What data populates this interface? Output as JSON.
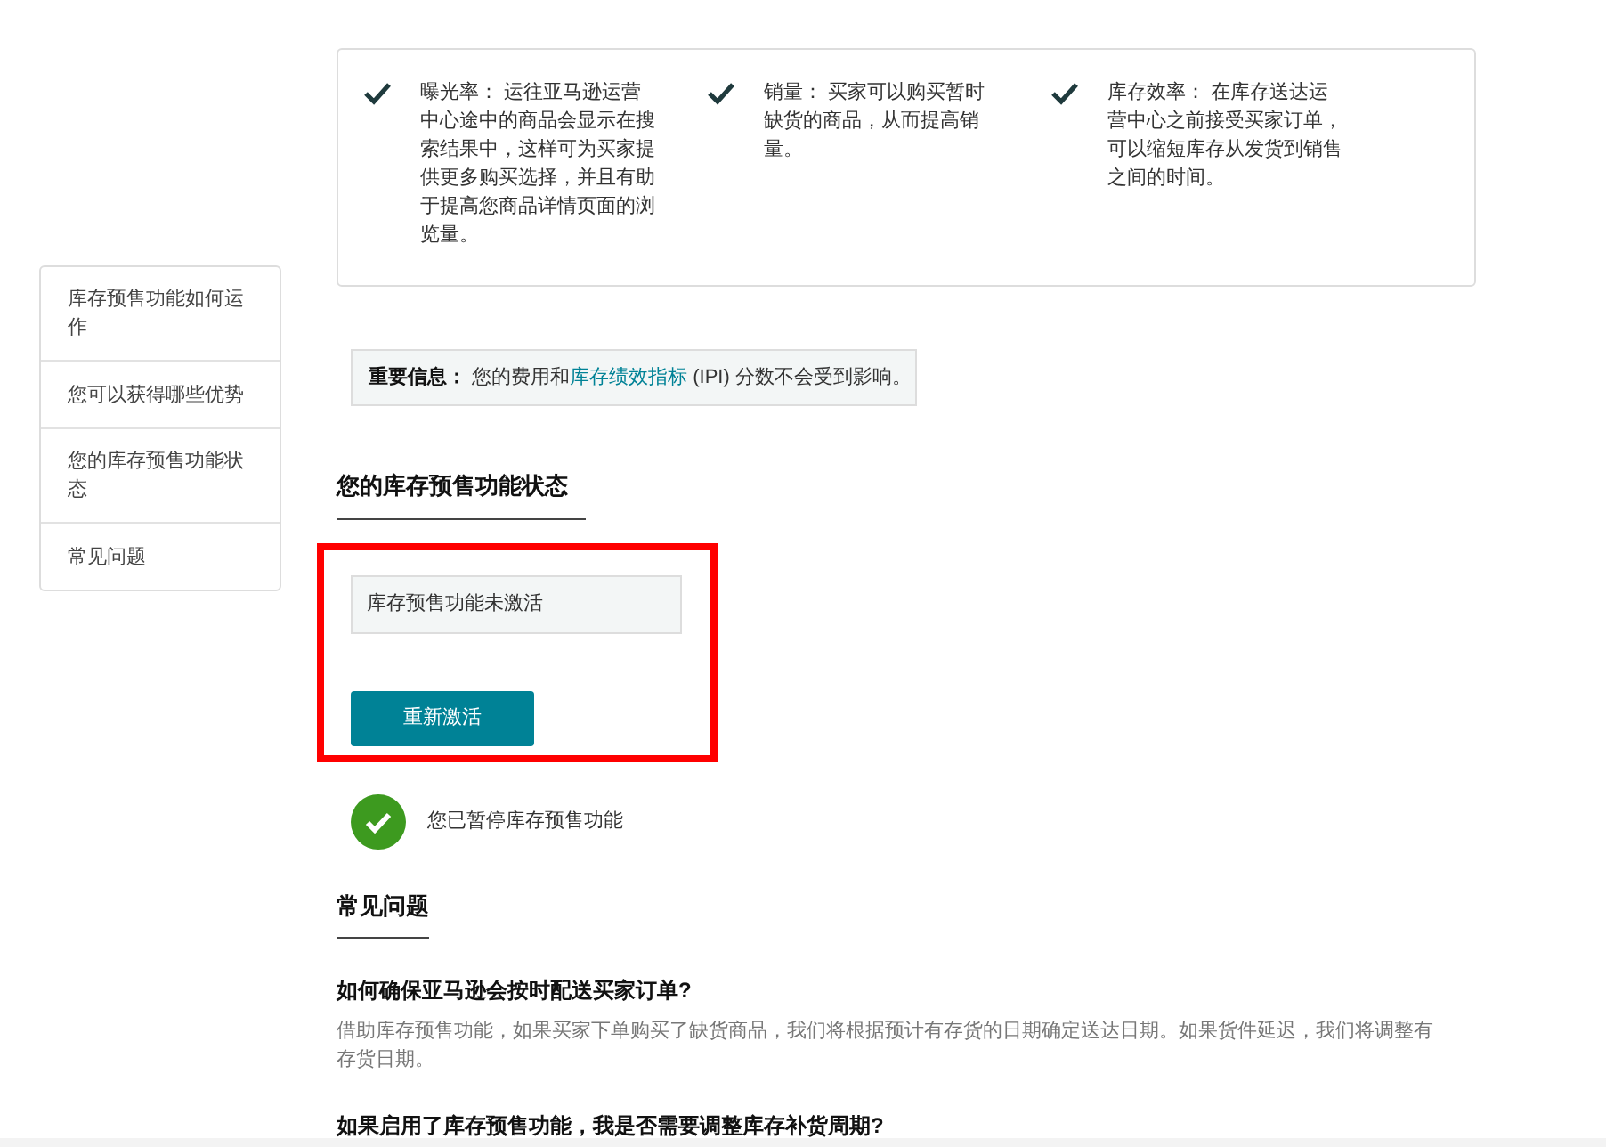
{
  "benefits": [
    {
      "title": "曝光率：",
      "text": "运往亚马逊运营中心途中的商品会显示在搜索结果中，这样可为买家提供更多购买选择，并且有助于提高您商品详情页面的浏览量。"
    },
    {
      "title": "销量：",
      "text": "买家可以购买暂时缺货的商品，从而提高销量。"
    },
    {
      "title": "库存效率：",
      "text": "在库存送达运营中心之前接受买家订单，可以缩短库存从发货到销售之间的时间。"
    }
  ],
  "sidebar": {
    "items": [
      "库存预售功能如何运作",
      "您可以获得哪些优势",
      "您的库存预售功能状态",
      "常见问题"
    ]
  },
  "notice": {
    "label": "重要信息：",
    "text_before": "您的费用和",
    "link": "库存绩效指标",
    "text_after": " (IPI) 分数不会受到影响。"
  },
  "status_section": {
    "heading": "您的库存预售功能状态",
    "status_field": "库存预售功能未激活",
    "button": "重新激活",
    "message": "您已暂停库存预售功能"
  },
  "faq": {
    "heading": "常见问题",
    "items": [
      {
        "question": "如何确保亚马逊会按时配送买家订单?",
        "answer": "借助库存预售功能，如果买家下单购买了缺货商品，我们将根据预计有存货的日期确定送达日期。如果货件延迟，我们将调整有存货日期。"
      },
      {
        "question": "如果启用了库存预售功能，我是否需要调整库存补货周期?"
      }
    ]
  }
}
